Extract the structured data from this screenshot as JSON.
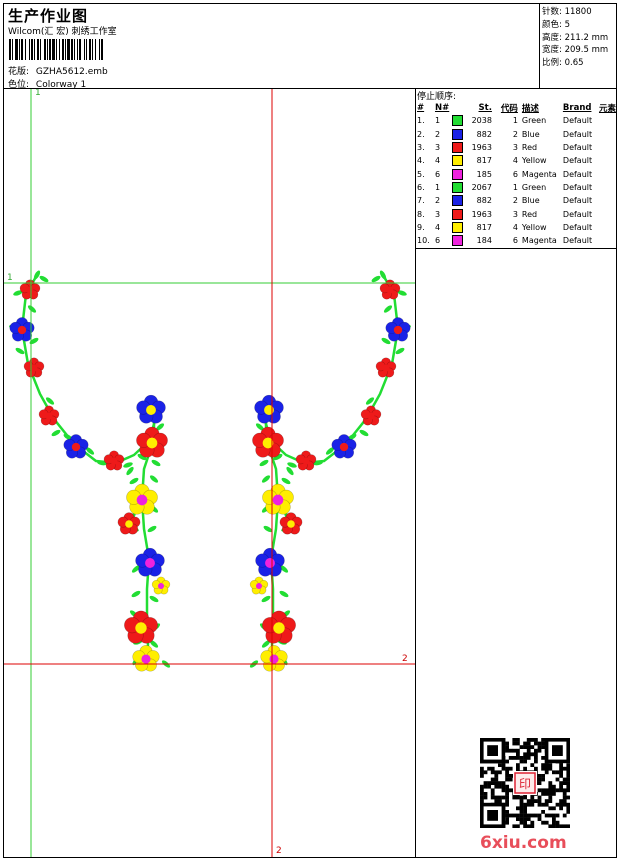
{
  "header": {
    "title": "生产作业图",
    "company": "Wilcom(汇 宏) 刺绣工作室",
    "file_label": "花版:",
    "file_name": "GZHA5612.emb",
    "colorway_label": "色位:",
    "colorway_name": "Colorway 1"
  },
  "stats": [
    {
      "label": "针数:",
      "value": "11800"
    },
    {
      "label": "颜色:",
      "value": "5"
    },
    {
      "label": "高度:",
      "value": "211.2 mm"
    },
    {
      "label": "宽度:",
      "value": "209.5 mm"
    },
    {
      "label": "比例:",
      "value": "0.65"
    }
  ],
  "stop_sequence": {
    "title": "停止顺序:",
    "headers": [
      "#",
      "N#",
      "St.",
      "代码",
      "描述",
      "Brand",
      "元素"
    ],
    "rows": [
      {
        "n": "1.",
        "nn": "1",
        "color": "#22dd33",
        "st": "2038",
        "code": "1",
        "desc": "Green",
        "brand": "Default"
      },
      {
        "n": "2.",
        "nn": "2",
        "color": "#1a22e6",
        "st": "882",
        "code": "2",
        "desc": "Blue",
        "brand": "Default"
      },
      {
        "n": "3.",
        "nn": "3",
        "color": "#ee1a1a",
        "st": "1963",
        "code": "3",
        "desc": "Red",
        "brand": "Default"
      },
      {
        "n": "4.",
        "nn": "4",
        "color": "#ffee00",
        "st": "817",
        "code": "4",
        "desc": "Yellow",
        "brand": "Default"
      },
      {
        "n": "5.",
        "nn": "6",
        "color": "#ee22dd",
        "st": "185",
        "code": "6",
        "desc": "Magenta",
        "brand": "Default"
      },
      {
        "n": "6.",
        "nn": "1",
        "color": "#22dd33",
        "st": "2067",
        "code": "1",
        "desc": "Green",
        "brand": "Default"
      },
      {
        "n": "7.",
        "nn": "2",
        "color": "#1a22e6",
        "st": "882",
        "code": "2",
        "desc": "Blue",
        "brand": "Default"
      },
      {
        "n": "8.",
        "nn": "3",
        "color": "#ee1a1a",
        "st": "1963",
        "code": "3",
        "desc": "Red",
        "brand": "Default"
      },
      {
        "n": "9.",
        "nn": "4",
        "color": "#ffee00",
        "st": "817",
        "code": "4",
        "desc": "Yellow",
        "brand": "Default"
      },
      {
        "n": "10.",
        "nn": "6",
        "color": "#ee22dd",
        "st": "184",
        "code": "6",
        "desc": "Magenta",
        "brand": "Default"
      }
    ]
  },
  "guides": {
    "green_label": "1",
    "red_label": "2"
  },
  "watermark": "6xiu.com",
  "seal_text": "印",
  "colors": {
    "green": "#22dd33",
    "blue": "#1a22e6",
    "red": "#ee1a1a",
    "yellow": "#ffee00",
    "magenta": "#ee22dd",
    "guide_green": "#33cc33",
    "guide_red": "#dd0000"
  }
}
